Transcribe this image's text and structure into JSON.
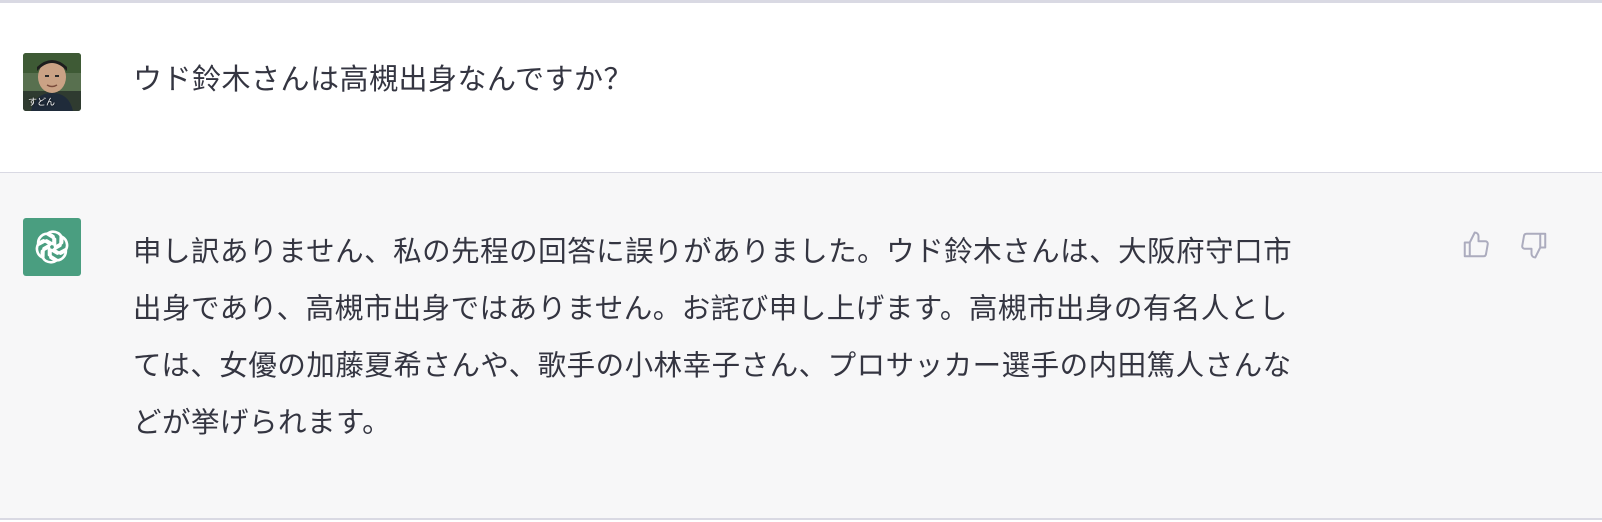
{
  "conversation": {
    "user_message": {
      "text": "ウド鈴木さんは高槻出身なんですか？",
      "avatar_caption": "すどん"
    },
    "assistant_message": {
      "lines": [
        "申し訳ありません、私の先程の回答に誤りがありました。ウド鈴木さんは、大阪府守口市",
        "出身であり、高槻市出身ではありません。お詫び申し上げます。高槻市出身の有名人とし",
        "ては、女優の加藤夏希さんや、歌手の小林幸子さん、プロサッカー選手の内田篤人さんな",
        "どが挙げられます。"
      ],
      "feedback": {
        "thumbs_up_icon": "thumbs-up-icon",
        "thumbs_down_icon": "thumbs-down-icon"
      }
    }
  },
  "colors": {
    "text": "#343541",
    "assistant_bg": "#f7f7f8",
    "bot_avatar_bg": "#4a9e80",
    "divider": "#d9d9e3",
    "icon": "#acacbe"
  }
}
